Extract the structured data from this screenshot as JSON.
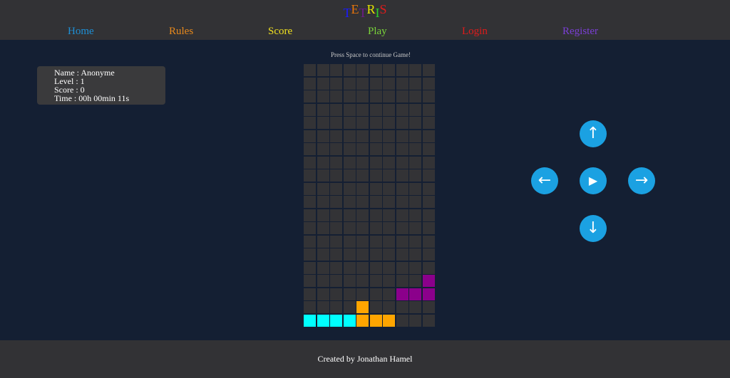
{
  "header": {
    "logo_letters": [
      {
        "char": "T",
        "color": "#1a1aff"
      },
      {
        "char": "E",
        "color": "#e8740c"
      },
      {
        "char": "T",
        "color": "#6e1a8a"
      },
      {
        "char": "R",
        "color": "#e6e600"
      },
      {
        "char": "I",
        "color": "#2ad02a"
      },
      {
        "char": "S",
        "color": "#e01b1b"
      }
    ],
    "nav": [
      {
        "label": "Home",
        "color": "#1e90d6"
      },
      {
        "label": "Rules",
        "color": "#e8891c"
      },
      {
        "label": "Score",
        "color": "#f0e020"
      },
      {
        "label": "Play",
        "color": "#7ad43a"
      },
      {
        "label": "Login",
        "color": "#e01b1b"
      },
      {
        "label": "Register",
        "color": "#7b3fd6"
      }
    ]
  },
  "player": {
    "name": "Name : Anonyme",
    "level": "Level : 1",
    "score": "Score : 0",
    "time": "Time : 00h 00min 11s"
  },
  "game": {
    "message": "Press Space to continue Game!",
    "columns": 10,
    "rows": 20,
    "empty_color": "#333336",
    "filled": [
      {
        "row": 16,
        "col": 9,
        "color": "#8b008b"
      },
      {
        "row": 17,
        "col": 7,
        "color": "#8b008b"
      },
      {
        "row": 17,
        "col": 8,
        "color": "#8b008b"
      },
      {
        "row": 17,
        "col": 9,
        "color": "#8b008b"
      },
      {
        "row": 18,
        "col": 4,
        "color": "#ffa500"
      },
      {
        "row": 19,
        "col": 4,
        "color": "#ffa500"
      },
      {
        "row": 19,
        "col": 5,
        "color": "#ffa500"
      },
      {
        "row": 19,
        "col": 6,
        "color": "#ffa500"
      },
      {
        "row": 19,
        "col": 0,
        "color": "#00ffff"
      },
      {
        "row": 19,
        "col": 1,
        "color": "#00ffff"
      },
      {
        "row": 19,
        "col": 2,
        "color": "#00ffff"
      },
      {
        "row": 19,
        "col": 3,
        "color": "#00ffff"
      }
    ]
  },
  "controls": {
    "up": {
      "icon": "arrow-up-icon",
      "glyph": "↑"
    },
    "left": {
      "icon": "arrow-left-icon",
      "glyph": "←"
    },
    "play": {
      "icon": "play-icon",
      "glyph": "▶"
    },
    "right": {
      "icon": "arrow-right-icon",
      "glyph": "→"
    },
    "down": {
      "icon": "arrow-down-icon",
      "glyph": "↓"
    },
    "color": "#1ba1e2"
  },
  "footer": {
    "text": "Created by Jonathan Hamel"
  }
}
